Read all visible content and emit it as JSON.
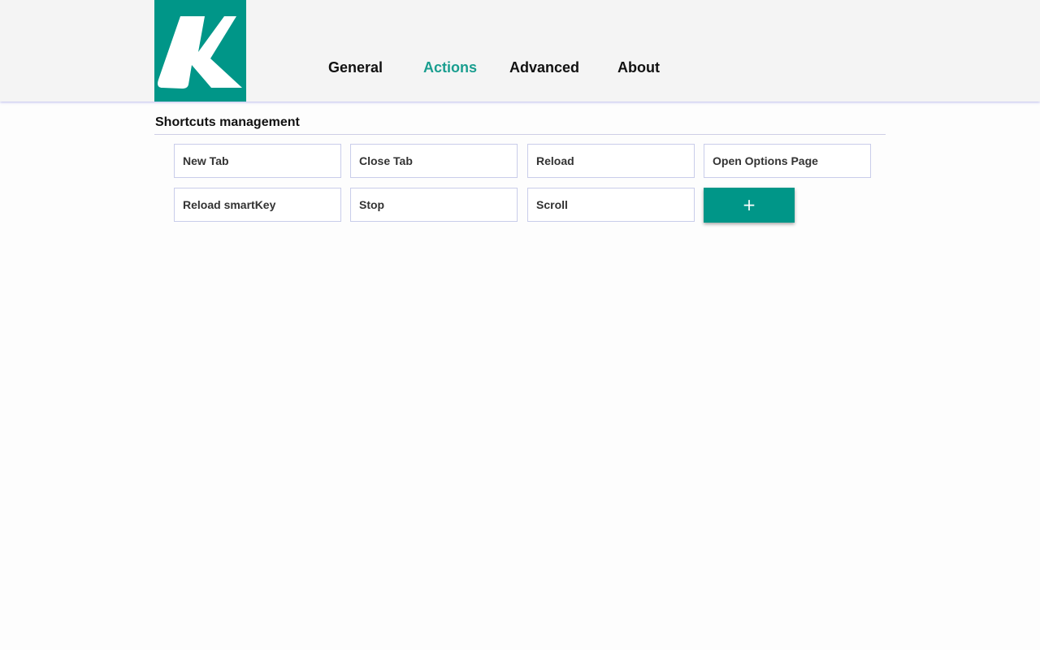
{
  "brand": {
    "logo_letter": "K",
    "color": "#009688"
  },
  "nav": {
    "items": [
      {
        "label": "General",
        "active": false
      },
      {
        "label": "Actions",
        "active": true
      },
      {
        "label": "Advanced",
        "active": false
      },
      {
        "label": "About",
        "active": false
      }
    ],
    "active_color": "#1a9e8f"
  },
  "section": {
    "title": "Shortcuts management"
  },
  "shortcuts": [
    {
      "label": "New Tab"
    },
    {
      "label": "Close Tab"
    },
    {
      "label": "Reload"
    },
    {
      "label": "Open Options Page"
    },
    {
      "label": "Reload smartKey"
    },
    {
      "label": "Stop"
    },
    {
      "label": "Scroll"
    }
  ],
  "add_button": {
    "glyph": "+",
    "icon": "plus-icon"
  }
}
